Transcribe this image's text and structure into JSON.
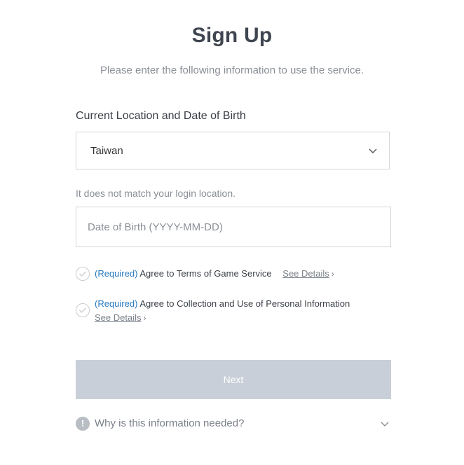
{
  "header": {
    "title": "Sign Up",
    "subtitle": "Please enter the following information to use the service."
  },
  "form": {
    "section_label": "Current Location and Date of Birth",
    "location": {
      "selected": "Taiwan"
    },
    "location_hint": "It does not match your login location.",
    "dob": {
      "value": "",
      "placeholder": "Date of Birth (YYYY-MM-DD)"
    },
    "agreements": [
      {
        "required_label": "(Required)",
        "text": " Agree to Terms of Game Service",
        "details_label": "See Details",
        "checked": false
      },
      {
        "required_label": "(Required)",
        "text": " Agree to Collection and Use of Personal Information",
        "details_label": "See Details",
        "checked": false
      }
    ],
    "next_label": "Next"
  },
  "faq": {
    "icon_glyph": "!",
    "question": "Why is this information needed?"
  },
  "colors": {
    "required": "#2a7bc0",
    "button_disabled": "#c8cfd8",
    "title": "#3f4650"
  },
  "icons": {
    "select_chevron": "chevron-down-icon",
    "agree_check": "check-icon",
    "info": "exclamation-icon",
    "faq_chevron": "chevron-down-icon",
    "details_arrow": "chevron-right-icon"
  }
}
